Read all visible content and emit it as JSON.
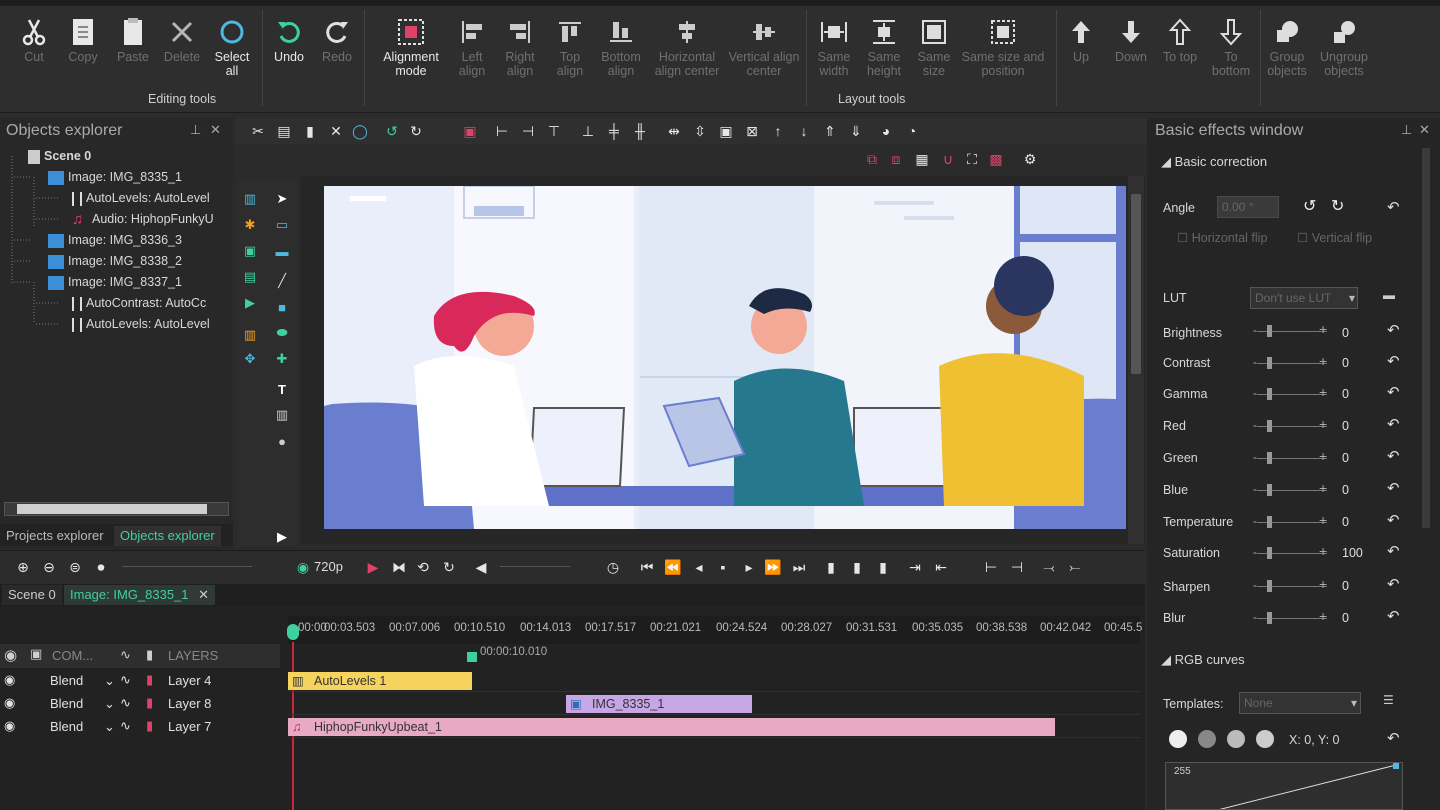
{
  "ribbon": {
    "buttons": [
      {
        "label": "Cut",
        "icon": "scissors-icon",
        "enabled": false
      },
      {
        "label": "Copy",
        "icon": "copy-icon",
        "enabled": false
      },
      {
        "label": "Paste",
        "icon": "paste-icon",
        "enabled": false
      },
      {
        "label": "Delete",
        "icon": "delete-icon",
        "enabled": false
      },
      {
        "label": "Select all",
        "icon": "select-all-icon",
        "enabled": true
      },
      {
        "label": "Undo",
        "icon": "undo-icon",
        "enabled": true
      },
      {
        "label": "Redo",
        "icon": "redo-icon",
        "enabled": false
      },
      {
        "label": "Alignment mode",
        "icon": "alignment-mode-icon",
        "enabled": true
      },
      {
        "label": "Left align",
        "icon": "left-align-icon",
        "enabled": false
      },
      {
        "label": "Right align",
        "icon": "right-align-icon",
        "enabled": false
      },
      {
        "label": "Top align",
        "icon": "top-align-icon",
        "enabled": false
      },
      {
        "label": "Bottom align",
        "icon": "bottom-align-icon",
        "enabled": false
      },
      {
        "label": "Horizontal align center",
        "icon": "horizontal-center-icon",
        "enabled": false
      },
      {
        "label": "Vertical align center",
        "icon": "vertical-center-icon",
        "enabled": false
      },
      {
        "label": "Same width",
        "icon": "same-width-icon",
        "enabled": false
      },
      {
        "label": "Same height",
        "icon": "same-height-icon",
        "enabled": false
      },
      {
        "label": "Same size",
        "icon": "same-size-icon",
        "enabled": false
      },
      {
        "label": "Same size and position",
        "icon": "same-size-position-icon",
        "enabled": false
      },
      {
        "label": "Up",
        "icon": "arrow-up-icon",
        "enabled": false
      },
      {
        "label": "Down",
        "icon": "arrow-down-icon",
        "enabled": false
      },
      {
        "label": "To top",
        "icon": "to-top-icon",
        "enabled": false
      },
      {
        "label": "To bottom",
        "icon": "to-bottom-icon",
        "enabled": false
      },
      {
        "label": "Group objects",
        "icon": "group-icon",
        "enabled": false
      },
      {
        "label": "Ungroup objects",
        "icon": "ungroup-icon",
        "enabled": false
      }
    ],
    "groups": {
      "editing": "Editing tools",
      "layout": "Layout tools"
    }
  },
  "objects_explorer": {
    "title": "Objects explorer",
    "tree": [
      {
        "label": "Scene 0",
        "type": "scene"
      },
      {
        "label": "Image: IMG_8335_1",
        "type": "image"
      },
      {
        "label": "AutoLevels: AutoLevel",
        "type": "effect"
      },
      {
        "label": "Audio: HiphopFunkyU",
        "type": "audio"
      },
      {
        "label": "Image: IMG_8336_3",
        "type": "image"
      },
      {
        "label": "Image: IMG_8338_2",
        "type": "image"
      },
      {
        "label": "Image: IMG_8337_1",
        "type": "image"
      },
      {
        "label": "AutoContrast: AutoCc",
        "type": "effect"
      },
      {
        "label": "AutoLevels: AutoLevel",
        "type": "effect"
      }
    ],
    "tabs": [
      "Projects explorer",
      "Objects explorer"
    ]
  },
  "effects": {
    "title": "Basic effects window",
    "section_basic": "Basic correction",
    "angle_label": "Angle",
    "angle_value": "0.00 °",
    "hflip": "Horizontal flip",
    "vflip": "Vertical flip",
    "lut_label": "LUT",
    "lut_value": "Don't use LUT",
    "rows": [
      {
        "label": "Brightness",
        "value": "0"
      },
      {
        "label": "Contrast",
        "value": "0"
      },
      {
        "label": "Gamma",
        "value": "0"
      },
      {
        "label": "Red",
        "value": "0"
      },
      {
        "label": "Green",
        "value": "0"
      },
      {
        "label": "Blue",
        "value": "0"
      },
      {
        "label": "Temperature",
        "value": "0"
      },
      {
        "label": "Saturation",
        "value": "100"
      },
      {
        "label": "Sharpen",
        "value": "0"
      },
      {
        "label": "Blur",
        "value": "0"
      }
    ],
    "section_rgb": "RGB curves",
    "templates_label": "Templates:",
    "templates_value": "None",
    "coords": "X: 0, Y: 0",
    "curve_max": "255"
  },
  "timeline": {
    "resolution": "720p",
    "tabs": [
      "Scene 0",
      "Image: IMG_8335_1"
    ],
    "ruler": [
      "00:00",
      "00:03.503",
      "00:07.006",
      "00:10.510",
      "00:14.013",
      "00:17.517",
      "00:21.021",
      "00:24.524",
      "00:28.027",
      "00:31.531",
      "00:35.035",
      "00:38.538",
      "00:42.042",
      "00:45.5"
    ],
    "cursor_time": "00:00:10.010",
    "header": {
      "com": "COM...",
      "layers": "LAYERS"
    },
    "layers": [
      {
        "blend": "Blend",
        "name": "Layer 4",
        "clip": "AutoLevels 1",
        "clip_color": "#f5d35c"
      },
      {
        "blend": "Blend",
        "name": "Layer 8",
        "clip": "IMG_8335_1",
        "clip_color": "#c7a6e6"
      },
      {
        "blend": "Blend",
        "name": "Layer 7",
        "clip": "HiphopFunkyUpbeat_1",
        "clip_color": "#e8a9c4"
      }
    ]
  },
  "colors": {
    "accent_green": "#3fd0a0",
    "select_cyan": "#4fb8e0",
    "audio_red": "#e0406a"
  }
}
